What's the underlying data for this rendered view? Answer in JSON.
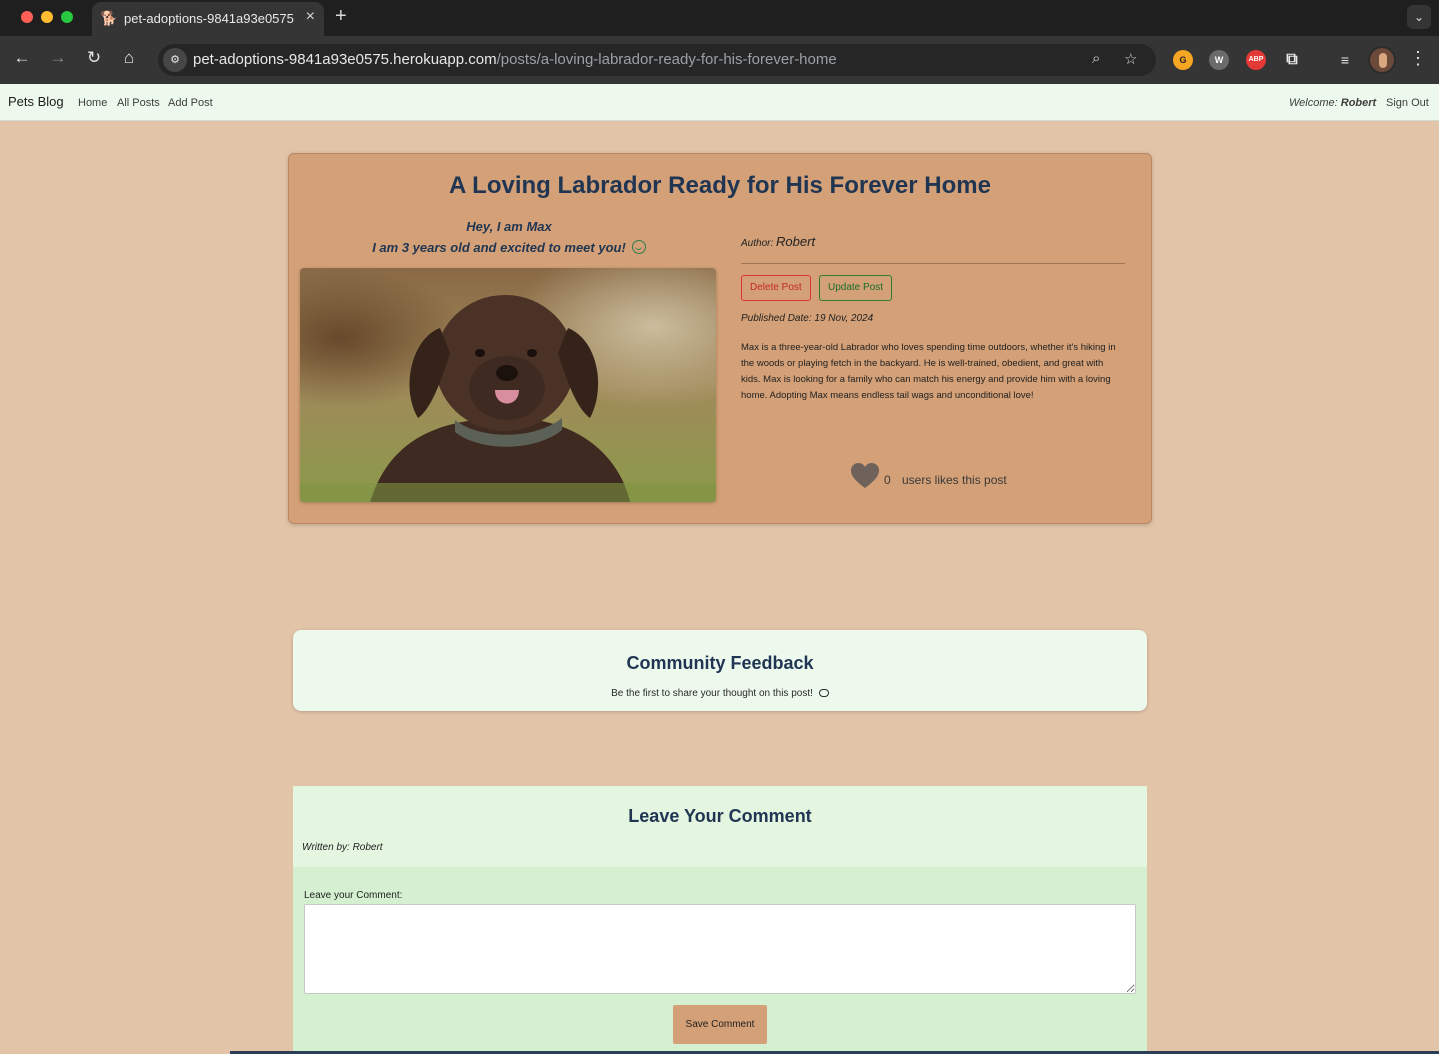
{
  "browser": {
    "tab_title": "pet-adoptions-9841a93e0575.herokuapp.com",
    "tab_favicon": "dog-icon",
    "url_host": "pet-adoptions-9841a93e0575.herokuapp.com",
    "url_path": "/posts/a-loving-labrador-ready-for-his-forever-home",
    "extensions": [
      "grammarly-icon",
      "wappalyzer-icon",
      "abp-icon",
      "puzzle-icon",
      "media-queue-icon"
    ],
    "ext_labels": {
      "wappalyzer": "W",
      "abp": "ABP"
    }
  },
  "navbar": {
    "brand": "Pets Blog",
    "links": [
      "Home",
      "All Posts",
      "Add Post"
    ],
    "welcome_label": "Welcome:",
    "welcome_user": "Robert",
    "signout": "Sign Out"
  },
  "post": {
    "title": "A Loving Labrador Ready for His Forever Home",
    "intro_line1": "Hey, I am Max",
    "intro_line2": "I am 3 years old and excited to meet you!",
    "author_label": "Author:",
    "author_name": "Robert",
    "delete_label": "Delete Post",
    "update_label": "Update Post",
    "published": "Published Date: 19 Nov, 2024",
    "body": "Max is a three-year-old Labrador who loves spending time outdoors, whether it's hiking in the woods or playing fetch in the backyard. He is well-trained, obedient, and great with kids. Max is looking for a family who can match his energy and provide him with a loving home. Adopting Max means endless tail wags and unconditional love!",
    "likes_count": "0",
    "likes_text": "users likes this post"
  },
  "feedback": {
    "title": "Community Feedback",
    "subtitle": "Be the first to share your thought on this post!"
  },
  "comment_form": {
    "title": "Leave Your Comment",
    "written_by": "Written by: Robert",
    "label": "Leave your Comment:",
    "value": "",
    "save_label": "Save Comment"
  },
  "colors": {
    "page_bg": "#e2c4a8",
    "card_bg": "#d3a077",
    "heading": "#1f3552",
    "navbar_bg": "#eef9ee",
    "comment_bg": "#d4f0d0",
    "delete": "#c62828",
    "update": "#1b6b2b"
  }
}
